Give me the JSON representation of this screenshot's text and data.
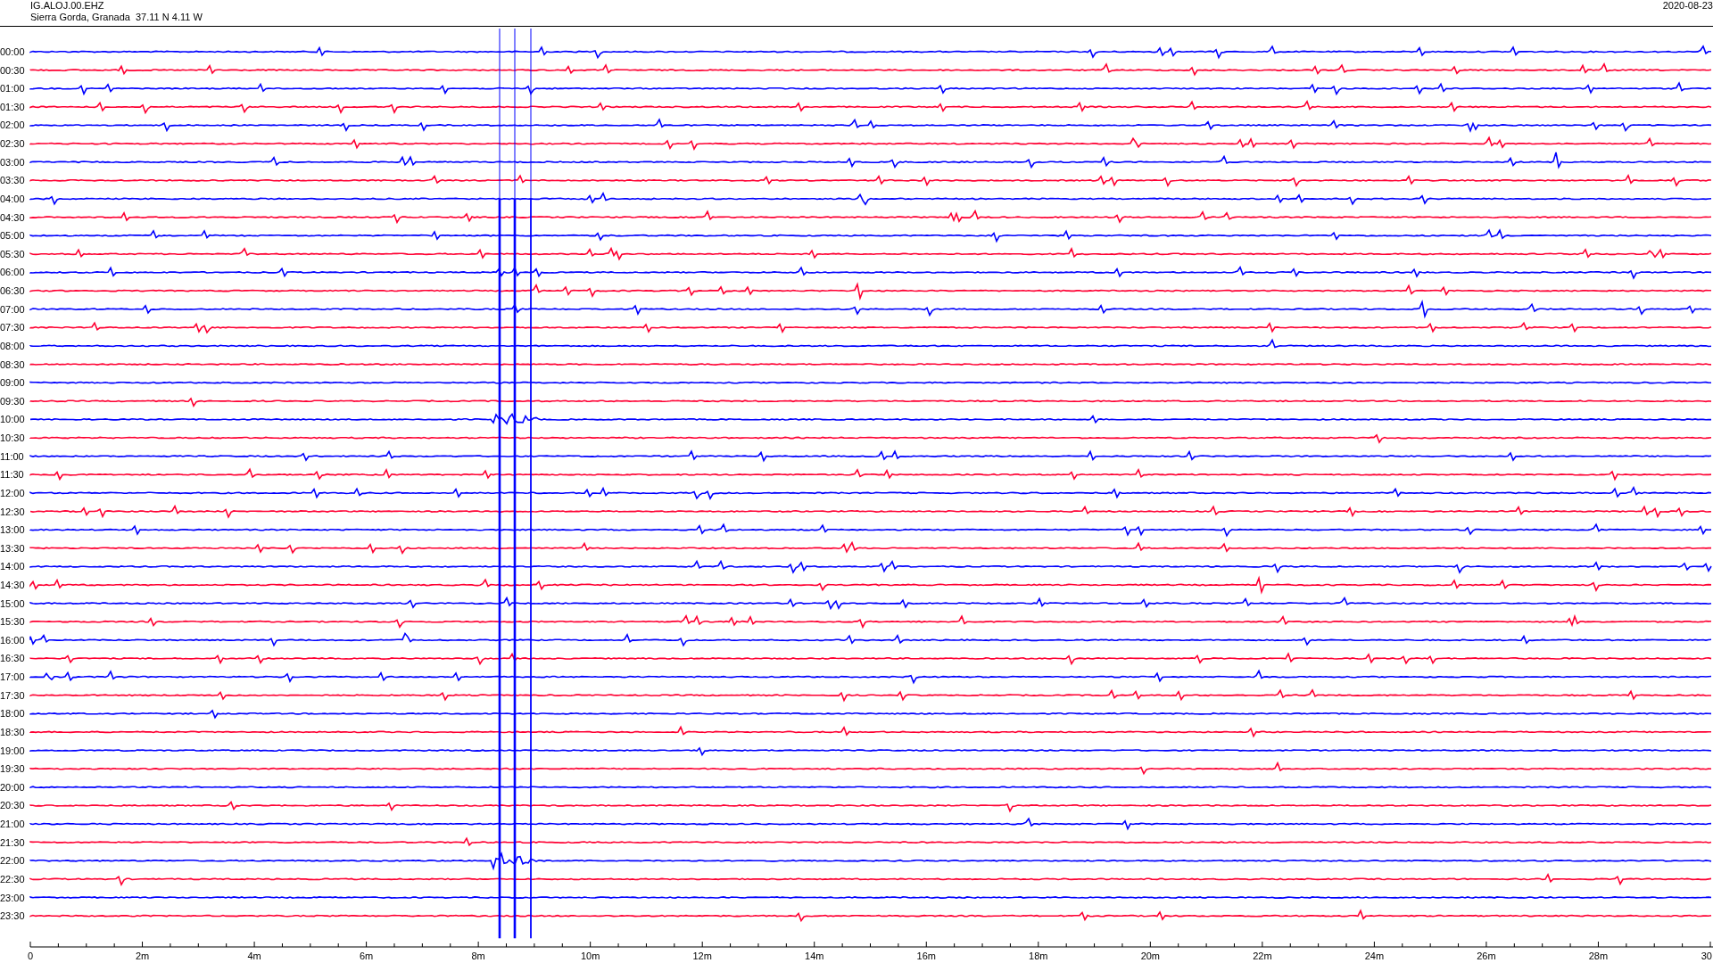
{
  "header": {
    "station": "IG.ALOJ.00.EHZ",
    "location": "Sierra Gorda, Granada  37.11 N 4.11 W",
    "date": "2020-08-23"
  },
  "helicorder": {
    "rows": [
      {
        "time": "00:00",
        "color": "#0000ff"
      },
      {
        "time": "00:30",
        "color": "#ff0033"
      },
      {
        "time": "01:00",
        "color": "#0000ff"
      },
      {
        "time": "01:30",
        "color": "#ff0033"
      },
      {
        "time": "02:00",
        "color": "#0000ff"
      },
      {
        "time": "02:30",
        "color": "#ff0033"
      },
      {
        "time": "03:00",
        "color": "#0000ff"
      },
      {
        "time": "03:30",
        "color": "#ff0033"
      },
      {
        "time": "04:00",
        "color": "#0000ff"
      },
      {
        "time": "04:30",
        "color": "#ff0033"
      },
      {
        "time": "05:00",
        "color": "#0000ff"
      },
      {
        "time": "05:30",
        "color": "#ff0033"
      },
      {
        "time": "06:00",
        "color": "#0000ff"
      },
      {
        "time": "06:30",
        "color": "#ff0033"
      },
      {
        "time": "07:00",
        "color": "#0000ff"
      },
      {
        "time": "07:30",
        "color": "#ff0033"
      },
      {
        "time": "08:00",
        "color": "#0000ff"
      },
      {
        "time": "08:30",
        "color": "#ff0033"
      },
      {
        "time": "09:00",
        "color": "#0000ff"
      },
      {
        "time": "09:30",
        "color": "#ff0033"
      },
      {
        "time": "10:00",
        "color": "#0000ff"
      },
      {
        "time": "10:30",
        "color": "#ff0033"
      },
      {
        "time": "11:00",
        "color": "#0000ff"
      },
      {
        "time": "11:30",
        "color": "#ff0033"
      },
      {
        "time": "12:00",
        "color": "#0000ff"
      },
      {
        "time": "12:30",
        "color": "#ff0033"
      },
      {
        "time": "13:00",
        "color": "#0000ff"
      },
      {
        "time": "13:30",
        "color": "#ff0033"
      },
      {
        "time": "14:00",
        "color": "#0000ff"
      },
      {
        "time": "14:30",
        "color": "#ff0033"
      },
      {
        "time": "15:00",
        "color": "#0000ff"
      },
      {
        "time": "15:30",
        "color": "#ff0033"
      },
      {
        "time": "16:00",
        "color": "#0000ff"
      },
      {
        "time": "16:30",
        "color": "#ff0033"
      },
      {
        "time": "17:00",
        "color": "#0000ff"
      },
      {
        "time": "17:30",
        "color": "#ff0033"
      },
      {
        "time": "18:00",
        "color": "#0000ff"
      },
      {
        "time": "18:30",
        "color": "#ff0033"
      },
      {
        "time": "19:00",
        "color": "#0000ff"
      },
      {
        "time": "19:30",
        "color": "#ff0033"
      },
      {
        "time": "20:00",
        "color": "#0000ff"
      },
      {
        "time": "20:30",
        "color": "#ff0033"
      },
      {
        "time": "21:00",
        "color": "#0000ff"
      },
      {
        "time": "21:30",
        "color": "#ff0033"
      },
      {
        "time": "22:00",
        "color": "#0000ff"
      },
      {
        "time": "22:30",
        "color": "#ff0033"
      },
      {
        "time": "23:00",
        "color": "#0000ff"
      },
      {
        "time": "23:30",
        "color": "#ff0033"
      }
    ],
    "x_axis": {
      "ticks": [
        "0",
        "2m",
        "4m",
        "6m",
        "8m",
        "10m",
        "12m",
        "14m",
        "16m",
        "18m",
        "20m",
        "22m",
        "24m",
        "26m",
        "28m",
        "30"
      ]
    }
  }
}
